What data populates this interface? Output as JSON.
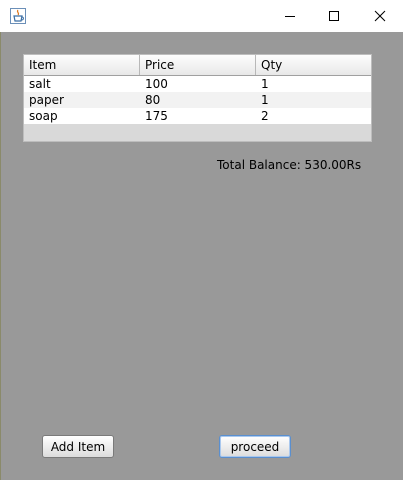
{
  "window": {
    "icon": "java-coffee-cup-icon",
    "controls": {
      "minimize": "minimize-icon",
      "maximize": "maximize-icon",
      "close": "close-icon"
    }
  },
  "table": {
    "columns": [
      "Item",
      "Price",
      "Qty"
    ],
    "rows": [
      [
        "salt",
        "100",
        "1"
      ],
      [
        "paper",
        "80",
        "1"
      ],
      [
        "soap",
        "175",
        "2"
      ]
    ]
  },
  "total_balance_label": "Total Balance: 530.00Rs",
  "buttons": {
    "add_item": "Add Item",
    "proceed": "proceed"
  },
  "colors": {
    "background": "#999999",
    "focus_border": "#5a8fcf"
  }
}
